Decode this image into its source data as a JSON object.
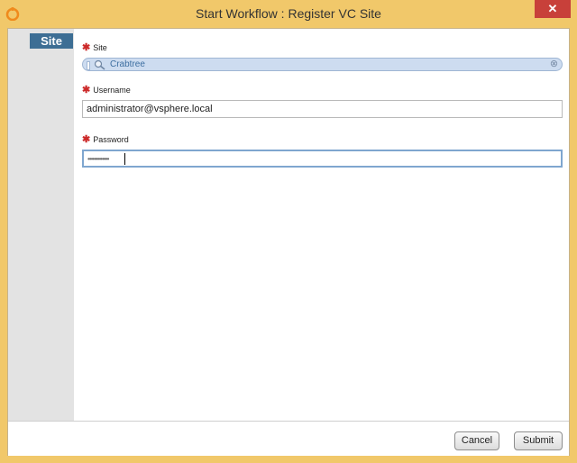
{
  "window": {
    "title": "Start Workflow : Register VC Site",
    "close_glyph": "✕"
  },
  "sidebar": {
    "tabs": [
      {
        "label": "Site",
        "selected": true
      }
    ]
  },
  "form": {
    "site": {
      "label": "Site",
      "required": true,
      "value": "Crabtree",
      "icon": "magnifier-icon",
      "clear_glyph": "⊗"
    },
    "username": {
      "label": "Username",
      "required": true,
      "value": "administrator@vsphere.local"
    },
    "password": {
      "label": "Password",
      "required": true,
      "masked_value": "•••••••••••••"
    },
    "required_marker": "✱"
  },
  "buttons": {
    "cancel": "Cancel",
    "submit": "Submit"
  },
  "colors": {
    "frame": "#f1c86a",
    "close": "#c8403a",
    "tab": "#3d6e94",
    "sidebar": "#e3e3e3",
    "required": "#cc2a2a",
    "site_pill": "#cddcf0"
  }
}
